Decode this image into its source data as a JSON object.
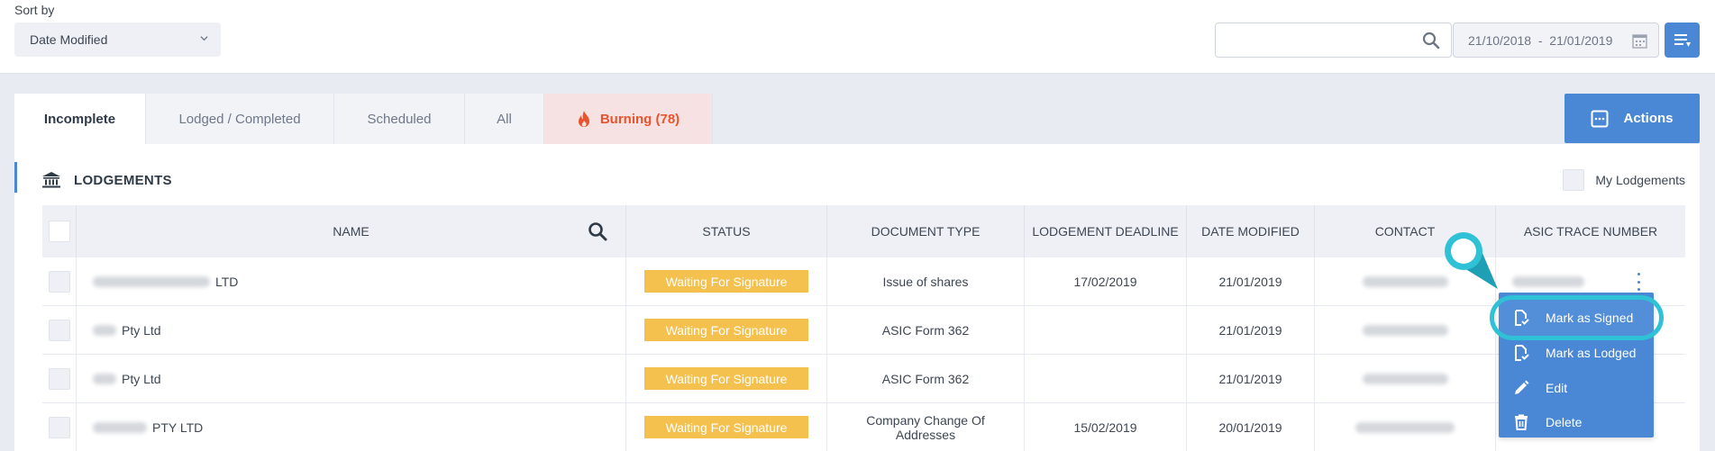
{
  "sort": {
    "label": "Sort by",
    "value": "Date Modified"
  },
  "search": {
    "value": "",
    "placeholder": ""
  },
  "date_range": {
    "value": "21/10/2018  -  21/01/2019"
  },
  "tabs": [
    {
      "label": "Incomplete"
    },
    {
      "label": "Lodged / Completed"
    },
    {
      "label": "Scheduled"
    },
    {
      "label": "All"
    },
    {
      "label": "Burning (78)"
    }
  ],
  "actions": {
    "label": "Actions"
  },
  "panel": {
    "title": "LODGEMENTS",
    "my_lodgements": "My Lodgements"
  },
  "table": {
    "headers": [
      "NAME",
      "STATUS",
      "DOCUMENT TYPE",
      "LODGEMENT DEADLINE",
      "DATE MODIFIED",
      "CONTACT",
      "ASIC TRACE NUMBER"
    ],
    "rows": [
      {
        "name_suffix": "LTD",
        "status": "Waiting For Signature",
        "doc_type": "Issue of shares",
        "deadline": "17/02/2019",
        "modified": "21/01/2019"
      },
      {
        "name_suffix": "Pty Ltd",
        "status": "Waiting For Signature",
        "doc_type": "ASIC Form 362",
        "deadline": "",
        "modified": "21/01/2019"
      },
      {
        "name_suffix": "Pty Ltd",
        "status": "Waiting For Signature",
        "doc_type": "ASIC Form 362",
        "deadline": "",
        "modified": "21/01/2019"
      },
      {
        "name_suffix": "PTY LTD",
        "status": "Waiting For Signature",
        "doc_type": "Company Change Of Addresses",
        "deadline": "15/02/2019",
        "modified": "20/01/2019"
      }
    ]
  },
  "menu": {
    "items": [
      {
        "label": "Mark as Signed",
        "icon": "document-check-icon"
      },
      {
        "label": "Mark as Lodged",
        "icon": "document-check-icon"
      },
      {
        "label": "Edit",
        "icon": "pencil-icon"
      },
      {
        "label": "Delete",
        "icon": "trash-icon"
      }
    ]
  },
  "colors": {
    "accent": "#4a88d6",
    "status_badge": "#f4c04e",
    "burning": "#e8542d",
    "highlight": "#2fc1d6"
  }
}
